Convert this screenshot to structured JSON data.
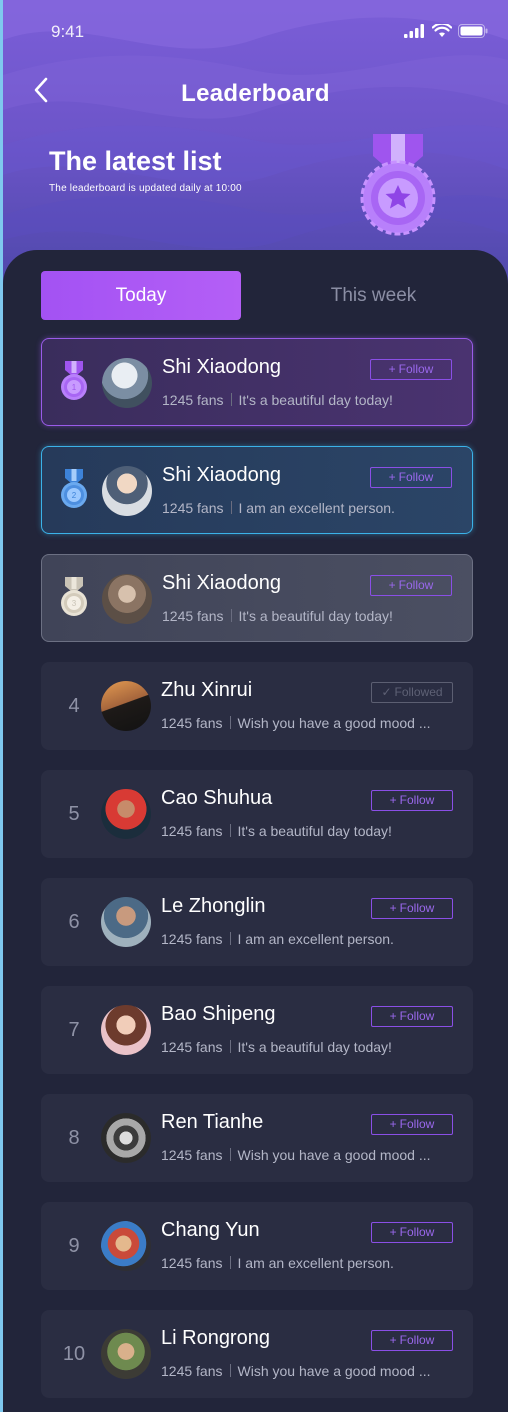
{
  "status_bar": {
    "time": "9:41"
  },
  "header": {
    "title": "Leaderboard",
    "hero_title": "The latest list",
    "hero_subtitle": "The leaderboard is updated daily at 10:00"
  },
  "tabs": [
    {
      "label": "Today",
      "active": true
    },
    {
      "label": "This week",
      "active": false
    }
  ],
  "entries": [
    {
      "rank": "1",
      "name": "Shi Xiaodong",
      "fans": "1245 fans",
      "bio": "It's a beautiful day today!",
      "button": "Follow",
      "followed": false,
      "medal": "gold-purple"
    },
    {
      "rank": "2",
      "name": "Shi Xiaodong",
      "fans": "1245 fans",
      "bio": "I am an excellent person.",
      "button": "Follow",
      "followed": false,
      "medal": "blue"
    },
    {
      "rank": "3",
      "name": "Shi Xiaodong",
      "fans": "1245 fans",
      "bio": "It's a beautiful day today!",
      "button": "Follow",
      "followed": false,
      "medal": "silver"
    },
    {
      "rank": "4",
      "name": "Zhu Xinrui",
      "fans": "1245 fans",
      "bio": "Wish you have a good mood ...",
      "button": "Followed",
      "followed": true
    },
    {
      "rank": "5",
      "name": "Cao Shuhua",
      "fans": "1245 fans",
      "bio": "It's a beautiful day today!",
      "button": "Follow",
      "followed": false
    },
    {
      "rank": "6",
      "name": "Le Zhonglin",
      "fans": "1245 fans",
      "bio": "I am an excellent person.",
      "button": "Follow",
      "followed": false
    },
    {
      "rank": "7",
      "name": "Bao Shipeng",
      "fans": "1245 fans",
      "bio": "It's a beautiful day today!",
      "button": "Follow",
      "followed": false
    },
    {
      "rank": "8",
      "name": "Ren Tianhe",
      "fans": "1245 fans",
      "bio": "Wish you have a good mood ...",
      "button": "Follow",
      "followed": false
    },
    {
      "rank": "9",
      "name": "Chang Yun",
      "fans": "1245 fans",
      "bio": "I am an excellent person.",
      "button": "Follow",
      "followed": false
    },
    {
      "rank": "10",
      "name": "Li Rongrong",
      "fans": "1245 fans",
      "bio": "Wish you have a good mood ...",
      "button": "Follow",
      "followed": false
    }
  ],
  "colors": {
    "accent": "#a352f3",
    "background": "#22253a",
    "card": "#2a2d42"
  }
}
